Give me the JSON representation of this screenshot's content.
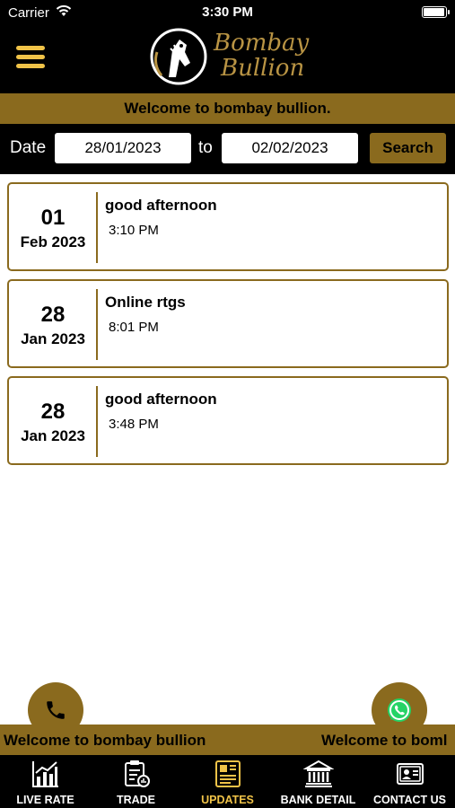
{
  "status_bar": {
    "carrier": "Carrier",
    "time": "3:30 PM"
  },
  "header": {
    "brand_line1": "Bombay",
    "brand_line2": "Bullion"
  },
  "banner": {
    "text": "Welcome to bombay bullion."
  },
  "filter": {
    "date_label": "Date",
    "from_value": "28/01/2023",
    "to_label": "to",
    "to_value": "02/02/2023",
    "search_label": "Search"
  },
  "updates": [
    {
      "day": "01",
      "month_year": "Feb 2023",
      "title": "good afternoon",
      "time": "3:10 PM"
    },
    {
      "day": "28",
      "month_year": "Jan 2023",
      "title": "Online rtgs",
      "time": "8:01 PM"
    },
    {
      "day": "28",
      "month_year": "Jan 2023",
      "title": "good afternoon",
      "time": "3:48 PM"
    }
  ],
  "ticker": {
    "text1": "Welcome to bombay bullion",
    "text2": "Welcome to boml"
  },
  "bottom_nav": [
    {
      "label": "LIVE RATE",
      "icon": "chart-icon"
    },
    {
      "label": "TRADE",
      "icon": "trade-doc-icon"
    },
    {
      "label": "UPDATES",
      "icon": "newspaper-icon",
      "active": true
    },
    {
      "label": "BANK DETAIL",
      "icon": "bank-icon"
    },
    {
      "label": "CONTACT US",
      "icon": "contact-card-icon"
    }
  ],
  "colors": {
    "accent_gold": "#8a6a1e",
    "active_gold": "#f0c348",
    "brand_text": "#b99444",
    "background_dark": "#000000"
  }
}
